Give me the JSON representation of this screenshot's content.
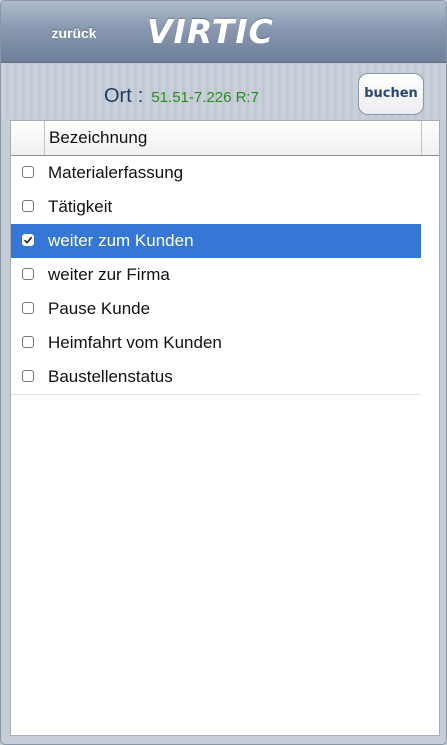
{
  "header": {
    "back_label": "zurück",
    "logo_text": "VIRTIC"
  },
  "location": {
    "label": "Ort",
    "separator": ":",
    "value": "51.51-7.226 R:7"
  },
  "book_button": {
    "label": "buchen"
  },
  "table": {
    "column_header": "Bezeichnung",
    "rows": [
      {
        "label": "Materialerfassung",
        "checked": false
      },
      {
        "label": "Tätigkeit",
        "checked": false
      },
      {
        "label": "weiter zum Kunden",
        "checked": true
      },
      {
        "label": "weiter zur Firma",
        "checked": false
      },
      {
        "label": "Pause Kunde",
        "checked": false
      },
      {
        "label": "Heimfahrt vom Kunden",
        "checked": false
      },
      {
        "label": "Baustellenstatus",
        "checked": false
      }
    ]
  },
  "colors": {
    "header_bar": "#7d8ea8",
    "selected_row": "#3577d6",
    "location_value": "#2a8a1c",
    "location_label": "#233a63"
  }
}
